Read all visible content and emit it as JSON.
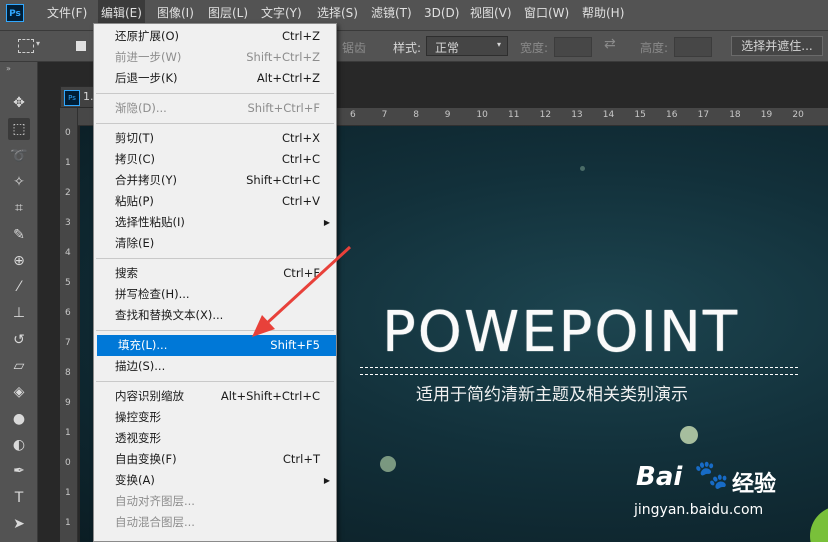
{
  "app": {
    "logo": "Ps"
  },
  "menubar": [
    {
      "label": "文件(F)",
      "active": false
    },
    {
      "label": "编辑(E)",
      "active": true
    },
    {
      "label": "图像(I)",
      "active": false
    },
    {
      "label": "图层(L)",
      "active": false
    },
    {
      "label": "文字(Y)",
      "active": false
    },
    {
      "label": "选择(S)",
      "active": false
    },
    {
      "label": "滤镜(T)",
      "active": false
    },
    {
      "label": "3D(D)",
      "active": false
    },
    {
      "label": "视图(V)",
      "active": false
    },
    {
      "label": "窗口(W)",
      "active": false
    },
    {
      "label": "帮助(H)",
      "active": false
    }
  ],
  "options": {
    "antialias_fragment": "锯齿",
    "style_label": "样式:",
    "style_value": "正常",
    "width_label": "宽度:",
    "height_label": "高度:",
    "select_mask_button": "选择并遮住..."
  },
  "document": {
    "tab_logo": "Ps",
    "tab_title": "1."
  },
  "ruler": {
    "top_ticks": [
      "6",
      "7",
      "8",
      "9",
      "10",
      "11",
      "12",
      "13",
      "14",
      "15",
      "16",
      "17",
      "18",
      "19",
      "20"
    ],
    "left_ticks": [
      "0",
      "1",
      "2",
      "3",
      "4",
      "5",
      "6",
      "7",
      "8",
      "9",
      "1",
      "0",
      "1",
      "1"
    ]
  },
  "canvas": {
    "title": "POWEPOINT",
    "subtitle": "适用于简约清新主题及相关类别演示"
  },
  "edit_menu": [
    {
      "label": "还原扩展(O)",
      "shortcut": "Ctrl+Z",
      "disabled": false
    },
    {
      "label": "前进一步(W)",
      "shortcut": "Shift+Ctrl+Z",
      "disabled": true
    },
    {
      "label": "后退一步(K)",
      "shortcut": "Alt+Ctrl+Z",
      "disabled": false
    },
    {
      "sep": true
    },
    {
      "label": "渐隐(D)...",
      "shortcut": "Shift+Ctrl+F",
      "disabled": true
    },
    {
      "sep": true
    },
    {
      "label": "剪切(T)",
      "shortcut": "Ctrl+X",
      "disabled": false
    },
    {
      "label": "拷贝(C)",
      "shortcut": "Ctrl+C",
      "disabled": false
    },
    {
      "label": "合并拷贝(Y)",
      "shortcut": "Shift+Ctrl+C",
      "disabled": false
    },
    {
      "label": "粘贴(P)",
      "shortcut": "Ctrl+V",
      "disabled": false
    },
    {
      "label": "选择性粘贴(I)",
      "shortcut": "",
      "disabled": false,
      "submenu": true
    },
    {
      "label": "清除(E)",
      "shortcut": "",
      "disabled": false
    },
    {
      "sep": true
    },
    {
      "label": "搜索",
      "shortcut": "Ctrl+F",
      "disabled": false
    },
    {
      "label": "拼写检查(H)...",
      "shortcut": "",
      "disabled": false
    },
    {
      "label": "查找和替换文本(X)...",
      "shortcut": "",
      "disabled": false
    },
    {
      "sep": true
    },
    {
      "label": "填充(L)...",
      "shortcut": "Shift+F5",
      "disabled": false,
      "highlighted": true
    },
    {
      "label": "描边(S)...",
      "shortcut": "",
      "disabled": false
    },
    {
      "sep": true
    },
    {
      "label": "内容识别缩放",
      "shortcut": "Alt+Shift+Ctrl+C",
      "disabled": false
    },
    {
      "label": "操控变形",
      "shortcut": "",
      "disabled": false
    },
    {
      "label": "透视变形",
      "shortcut": "",
      "disabled": false
    },
    {
      "label": "自由变换(F)",
      "shortcut": "Ctrl+T",
      "disabled": false
    },
    {
      "label": "变换(A)",
      "shortcut": "",
      "disabled": false,
      "submenu": true
    },
    {
      "label": "自动对齐图层...",
      "shortcut": "",
      "disabled": true
    },
    {
      "label": "自动混合图层...",
      "shortcut": "",
      "disabled": true
    }
  ],
  "tools": [
    "move-icon",
    "marquee-icon",
    "lasso-icon",
    "magic-wand-icon",
    "crop-icon",
    "eyedropper-icon",
    "healing-icon",
    "brush-icon",
    "stamp-icon",
    "history-brush-icon",
    "eraser-icon",
    "paint-bucket-icon",
    "blur-icon",
    "dodge-icon",
    "pen-icon",
    "type-icon",
    "path-select-icon"
  ],
  "watermark": {
    "brand": "Bai",
    "brand2": "经验",
    "url": "jingyan.baidu.com"
  },
  "colors": {
    "highlight": "#0078d7",
    "arrow": "#e8413a",
    "menu_bg": "#f0f0f0",
    "ui_bg": "#535353"
  }
}
